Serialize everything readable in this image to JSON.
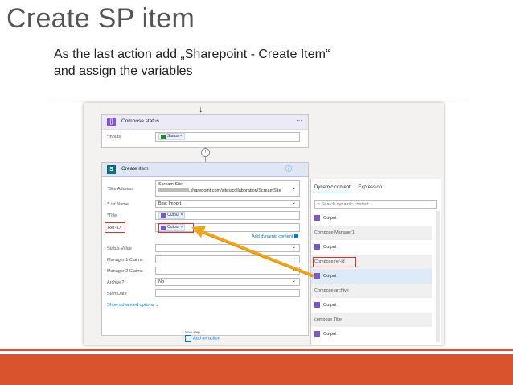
{
  "slide": {
    "title": "Create SP item",
    "subtitle_line1": "As the last action add „Sharepoint  - Create Item“",
    "subtitle_line2": "and assign the variables"
  },
  "compose": {
    "title": "Compose status",
    "inputs_label": "*Inputs",
    "token": "Status"
  },
  "create_item": {
    "title": "Create item",
    "site_label": "*Site Address",
    "site_line1": "Scream Site -",
    "site_line2": ".sharepoint.com/sites/collaboration/ScreamSite",
    "list_label": "*List Name",
    "list_value": "Bxe: Import",
    "title_label": "*Title",
    "title_token": "Output",
    "refid_label": "Ref-ID",
    "refid_token": "Output",
    "add_dynamic": "Add dynamic content",
    "status_label": "Status Value",
    "mgr1_label": "Manager 1 Claims",
    "mgr2_label": "Manager 2 Claims",
    "archive_label": "Archive?",
    "archive_value": "No",
    "start_label": "Start Date",
    "show_adv": "Show advanced options",
    "new_step": "New step",
    "add_action": "Add an action"
  },
  "panel": {
    "tab_dynamic": "Dynamic content",
    "tab_expression": "Expression",
    "search_placeholder": "Search dynamic content",
    "items": [
      {
        "kind": "item",
        "label": "Output"
      },
      {
        "kind": "section",
        "label": "Compose Manager1"
      },
      {
        "kind": "item",
        "label": "Output"
      },
      {
        "kind": "section",
        "label": "Compose ref-id"
      },
      {
        "kind": "item",
        "label": "Output"
      },
      {
        "kind": "section",
        "label": "Compose archive"
      },
      {
        "kind": "item",
        "label": "Output"
      },
      {
        "kind": "section",
        "label": "compose Title"
      },
      {
        "kind": "item",
        "label": "Output"
      }
    ]
  },
  "colors": {
    "accent_orange": "#d9532c",
    "highlight_red": "#d9302c",
    "arrow_yellow": "#f2a51a",
    "flow_purple": "#7f56c9",
    "sharepoint_teal": "#0f6c74"
  }
}
